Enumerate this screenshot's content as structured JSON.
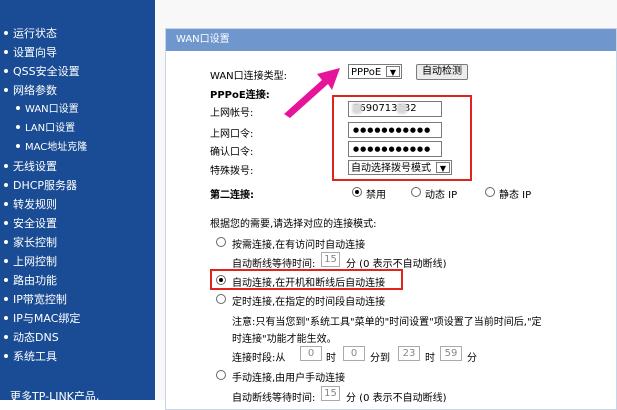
{
  "sidebar": {
    "items": [
      {
        "label": "运行状态",
        "sub": false
      },
      {
        "label": "设置向导",
        "sub": false
      },
      {
        "label": "QSS安全设置",
        "sub": false
      },
      {
        "label": "网络参数",
        "sub": false
      },
      {
        "label": "WAN口设置",
        "sub": true
      },
      {
        "label": "LAN口设置",
        "sub": true
      },
      {
        "label": "MAC地址克隆",
        "sub": true
      },
      {
        "label": "无线设置",
        "sub": false
      },
      {
        "label": "DHCP服务器",
        "sub": false
      },
      {
        "label": "转发规则",
        "sub": false
      },
      {
        "label": "安全设置",
        "sub": false
      },
      {
        "label": "家长控制",
        "sub": false
      },
      {
        "label": "上网控制",
        "sub": false
      },
      {
        "label": "路由功能",
        "sub": false
      },
      {
        "label": "IP带宽控制",
        "sub": false
      },
      {
        "label": "IP与MAC绑定",
        "sub": false
      },
      {
        "label": "动态DNS",
        "sub": false
      },
      {
        "label": "系统工具",
        "sub": false
      }
    ],
    "more_label": "更多TP-LINK产品,"
  },
  "panel": {
    "title": "WAN口设置",
    "wan_type_label": "WAN口连接类型:",
    "wan_type_value": "PPPoE",
    "detect_button": "自动检测",
    "pppoe_label": "PPPoE连接:",
    "account_label": "上网帐号:",
    "account_value": "7690713132",
    "password_label": "上网口令:",
    "password_value": "●●●●●●●●●●●",
    "confirm_label": "确认口令:",
    "confirm_value": "●●●●●●●●●●●",
    "dial_label": "特殊拨号:",
    "dial_value": "自动选择拨号模式",
    "second_label": "第二连接:",
    "second_options": [
      "禁用",
      "动态 IP",
      "静态 IP"
    ],
    "second_selected": 0,
    "mode_prompt": "根据您的需要,请选择对应的连接模式:",
    "mode_demand": "按需连接,在有访问时自动连接",
    "idle_label": "自动断线等待时间:",
    "idle_value": "15",
    "idle_unit": "分 (0 表示不自动断线)",
    "mode_auto": "自动连接,在开机和断线后自动连接",
    "mode_timed": "定时连接,在指定的时间段自动连接",
    "timed_note_1": "注意:只有当您到\"系统工具\"菜单的\"时间设置\"项设置了当前时间后,\"定",
    "timed_note_2": "时连接\"功能才能生效。",
    "period_label": "连接时段:从",
    "period_h1": "0",
    "period_sep1": "时",
    "period_m1": "0",
    "period_sep2": "分到",
    "period_h2": "23",
    "period_sep3": "时",
    "period_m2": "59",
    "period_sep4": "分",
    "mode_manual": "手动连接,由用户手动连接",
    "idle2_label": "自动断线等待时间:",
    "idle2_value": "15",
    "idle2_unit": "分 (0 表示不自动断线)"
  },
  "colors": {
    "sidebar_bg": "#1a4c95",
    "header_bg": "#6f97cd",
    "highlight": "#e0231e",
    "arrow": "#e6149b"
  }
}
